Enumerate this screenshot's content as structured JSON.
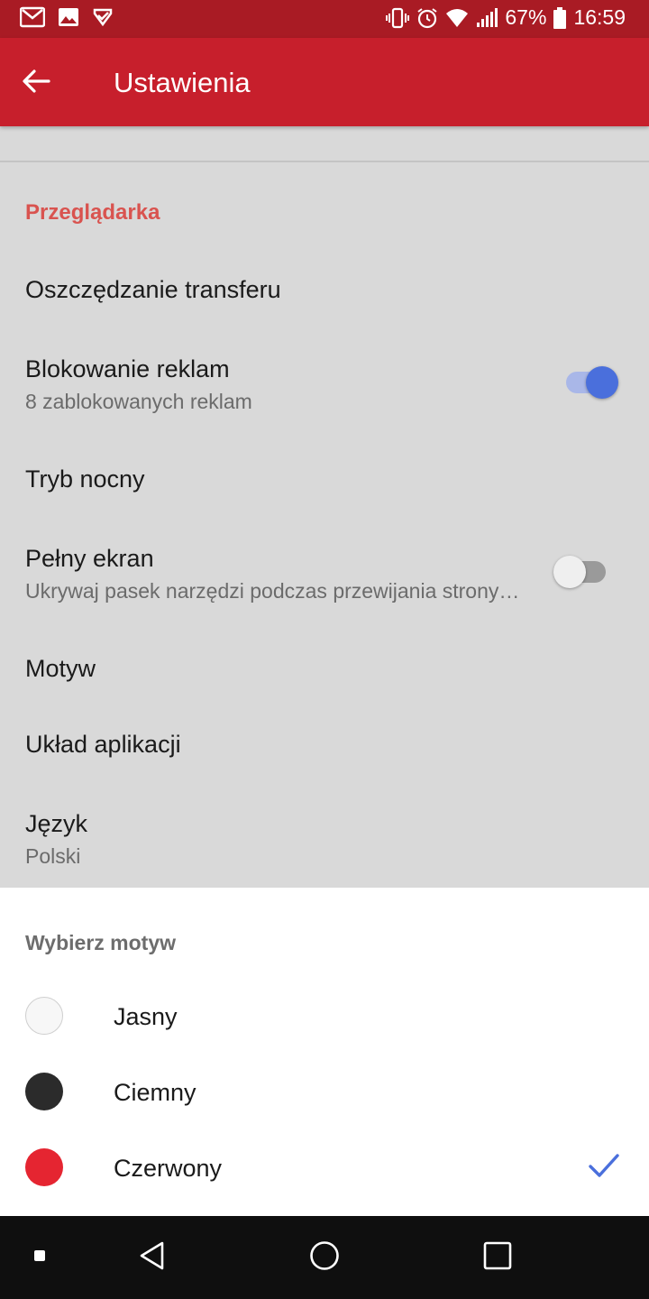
{
  "status_bar": {
    "battery": "67%",
    "time": "16:59"
  },
  "appbar": {
    "title": "Ustawienia"
  },
  "section": {
    "header": "Przeglądarka"
  },
  "prefs": {
    "data_saving": {
      "title": "Oszczędzanie transferu"
    },
    "ad_blocking": {
      "title": "Blokowanie reklam",
      "subtitle": "8 zablokowanych reklam",
      "enabled": true
    },
    "night_mode": {
      "title": "Tryb nocny"
    },
    "full_screen": {
      "title": "Pełny ekran",
      "subtitle": "Ukrywaj pasek narzędzi podczas przewijania strony…",
      "enabled": false
    },
    "theme": {
      "title": "Motyw"
    },
    "app_layout": {
      "title": "Układ aplikacji"
    },
    "language": {
      "title": "Język",
      "subtitle": "Polski"
    }
  },
  "theme_sheet": {
    "title": "Wybierz motyw",
    "options": [
      {
        "label": "Jasny",
        "color": "#f7f7f7",
        "selected": false
      },
      {
        "label": "Ciemny",
        "color": "#2b2b2b",
        "selected": false
      },
      {
        "label": "Czerwony",
        "color": "#e52531",
        "selected": true
      }
    ]
  },
  "colors": {
    "status_bar": "#a91b24",
    "app_bar": "#c71f2c",
    "accent_header": "#d9534f",
    "toggle_on": "#4a6fdc",
    "check": "#4a6fdc"
  }
}
